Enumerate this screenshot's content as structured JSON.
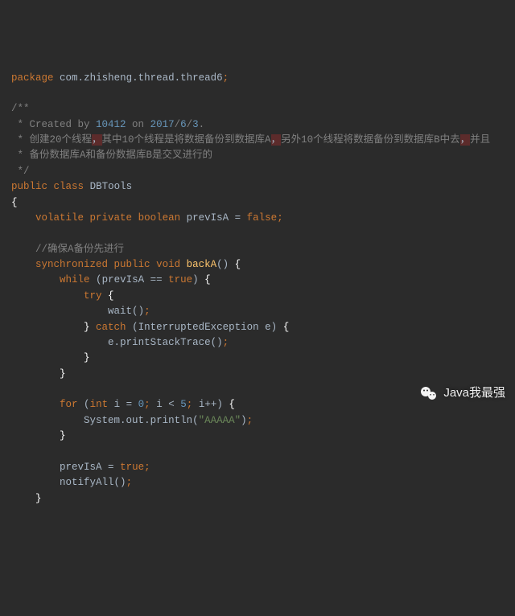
{
  "pkg_kw": "package",
  "pkg": {
    "p1": "com",
    "p2": "zhisheng",
    "p3": "thread",
    "p4": "thread6"
  },
  "doc": {
    "open": "/**",
    "l1_a": " * Created by ",
    "l1_num": "10412",
    "l1_b": " on ",
    "l1_y": "2017",
    "l1_m": "6",
    "l1_d": "3",
    "l2_a": " * 创建20个线程",
    "l2_b": "其中10个线程是将数据备份到数据库A",
    "l2_c": "另外10个线程将数据备份到数据库B中去",
    "l2_d": "并且",
    "l3": " * 备份数据库A和备份数据库B是交叉进行的",
    "close": " */"
  },
  "class": {
    "public": "public",
    "class_kw": "class",
    "name": "DBTools",
    "lbrace": "{",
    "field": {
      "volatile": "volatile",
      "private": "private",
      "boolean": "boolean",
      "name": "prevIsA",
      "eq": "=",
      "false": "false"
    },
    "comment_a": "//确保A备份先进行",
    "m_backA": {
      "sync": "synchronized",
      "public": "public",
      "void": "void",
      "name": "backA",
      "while_kw": "while",
      "cond_var": "prevIsA",
      "eqeq": "==",
      "true": "true",
      "try_kw": "try",
      "wait": "wait",
      "catch_kw": "catch",
      "exc_type": "InterruptedException",
      "exc_var": "e",
      "pst": "printStackTrace",
      "for_kw": "for",
      "int_kw": "int",
      "i": "i",
      "zero": "0",
      "lt": "<",
      "five": "5",
      "inc": "++",
      "system": "System",
      "out": "out",
      "println": "println",
      "str": "\"AAAAA\"",
      "assign_var": "prevIsA",
      "true2": "true",
      "notify": "notifyAll"
    }
  },
  "watermark": "Java我最强",
  "punct": {
    "dot": ".",
    "semi": ";",
    "slash": "/",
    "lbrace": "{",
    "rbrace": "}",
    "lparen": "(",
    "rparen": ")",
    "comma": ",",
    "hl": "，",
    "eq": "="
  }
}
